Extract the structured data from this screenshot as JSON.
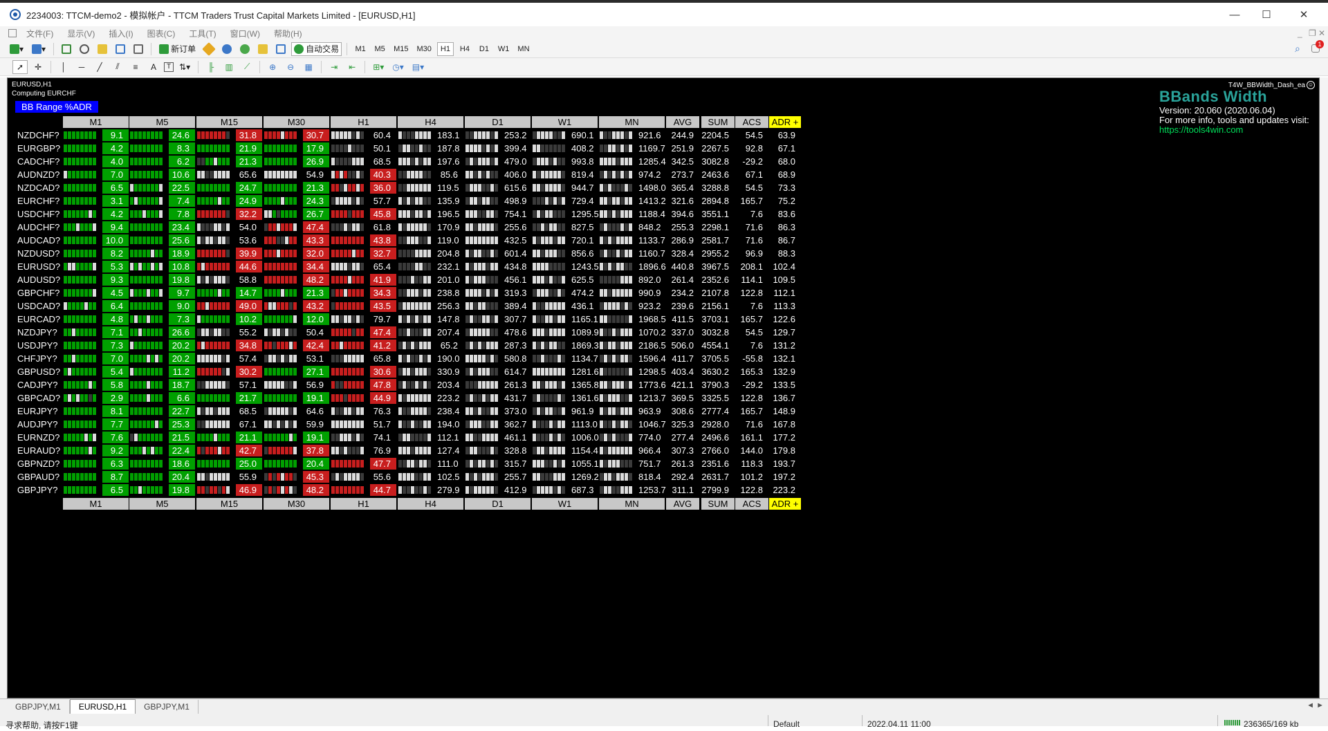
{
  "window": {
    "title": "2234003: TTCM-demo2 - 模拟帐户 - TTCM Traders Trust Capital Markets Limited - [EURUSD,H1]",
    "controls": [
      "—",
      "☐",
      "✕"
    ]
  },
  "menu": {
    "items": [
      "文件(F)",
      "显示(V)",
      "插入(I)",
      "图表(C)",
      "工具(T)",
      "窗口(W)",
      "帮助(H)"
    ],
    "right_controls": [
      "_",
      "❐",
      "✕"
    ]
  },
  "toolbar1": {
    "new_order_label": "新订单",
    "auto_trade_label": "自动交易",
    "timeframes": [
      "M1",
      "M5",
      "M15",
      "M30",
      "H1",
      "H4",
      "D1",
      "W1",
      "MN"
    ],
    "active_timeframe": "H1",
    "notification_count": "1"
  },
  "toolbar2": {
    "text_tool": "A",
    "label_tool": "T"
  },
  "chart": {
    "symbol_line": "EURUSD,H1",
    "computing": "Computing EURCHF",
    "ea_name": "T4W_BBWidth_Dash_ea",
    "ea_close": "☺",
    "badge": "BB Range %ADR",
    "brand_title": "BBands Width",
    "brand_version": "Version: 20.060 (2020.06.04)",
    "brand_info": "For more info, tools and updates visit:",
    "brand_link": "https://tools4win.com",
    "headers": [
      "M1",
      "M5",
      "M15",
      "M30",
      "H1",
      "H4",
      "D1",
      "W1",
      "MN",
      "AVG",
      "SUM",
      "ACS",
      "ADR +"
    ],
    "colors": {
      "green": "#00a000",
      "red": "#c81e1e",
      "bar_white": "#dcdcdc",
      "bar_dark": "#3a3a3a",
      "adr_header": "#ffff00"
    },
    "rows": [
      {
        "pair": "NZDCHF?",
        "v": [
          "9.1",
          "24.6",
          "31.8",
          "30.7",
          "60.4",
          "183.1",
          "253.2",
          "690.1",
          "921.6"
        ],
        "avg": "244.9",
        "sum": "2204.5",
        "acs": "54.5",
        "adr": "63.9"
      },
      {
        "pair": "EURGBP?",
        "v": [
          "4.2",
          "8.3",
          "21.9",
          "17.9",
          "50.1",
          "187.8",
          "399.4",
          "408.2",
          "1169.7"
        ],
        "avg": "251.9",
        "sum": "2267.5",
        "acs": "92.8",
        "adr": "67.1"
      },
      {
        "pair": "CADCHF?",
        "v": [
          "4.0",
          "6.2",
          "21.3",
          "26.9",
          "68.5",
          "197.6",
          "479.0",
          "993.8",
          "1285.4"
        ],
        "avg": "342.5",
        "sum": "3082.8",
        "acs": "-29.2",
        "adr": "68.0"
      },
      {
        "pair": "AUDNZD?",
        "v": [
          "7.0",
          "10.6",
          "65.6",
          "54.9",
          "40.3",
          "85.6",
          "406.0",
          "819.4",
          "974.2"
        ],
        "avg": "273.7",
        "sum": "2463.6",
        "acs": "67.1",
        "adr": "68.9"
      },
      {
        "pair": "NZDCAD?",
        "v": [
          "6.5",
          "22.5",
          "24.7",
          "21.3",
          "36.0",
          "119.5",
          "615.6",
          "944.7",
          "1498.0"
        ],
        "avg": "365.4",
        "sum": "3288.8",
        "acs": "54.5",
        "adr": "73.3"
      },
      {
        "pair": "EURCHF?",
        "v": [
          "3.1",
          "7.4",
          "24.9",
          "24.3",
          "57.7",
          "135.9",
          "498.9",
          "729.4",
          "1413.2"
        ],
        "avg": "321.6",
        "sum": "2894.8",
        "acs": "165.7",
        "adr": "75.2"
      },
      {
        "pair": "USDCHF?",
        "v": [
          "4.2",
          "7.8",
          "32.2",
          "26.7",
          "45.8",
          "196.5",
          "754.1",
          "1295.5",
          "1188.4"
        ],
        "avg": "394.6",
        "sum": "3551.1",
        "acs": "7.6",
        "adr": "83.6"
      },
      {
        "pair": "AUDCHF?",
        "v": [
          "9.4",
          "23.4",
          "54.0",
          "47.4",
          "61.8",
          "170.9",
          "255.6",
          "827.5",
          "848.2"
        ],
        "avg": "255.3",
        "sum": "2298.1",
        "acs": "71.6",
        "adr": "86.3"
      },
      {
        "pair": "AUDCAD?",
        "v": [
          "10.0",
          "25.6",
          "53.6",
          "43.3",
          "43.8",
          "119.0",
          "432.5",
          "720.1",
          "1133.7"
        ],
        "avg": "286.9",
        "sum": "2581.7",
        "acs": "71.6",
        "adr": "86.7"
      },
      {
        "pair": "NZDUSD?",
        "v": [
          "8.2",
          "18.9",
          "39.9",
          "32.0",
          "32.7",
          "204.8",
          "601.4",
          "856.6",
          "1160.7"
        ],
        "avg": "328.4",
        "sum": "2955.2",
        "acs": "96.9",
        "adr": "88.3"
      },
      {
        "pair": "EURUSD?",
        "v": [
          "5.3",
          "10.8",
          "44.6",
          "34.4",
          "65.4",
          "232.1",
          "434.8",
          "1243.5",
          "1896.6"
        ],
        "avg": "440.8",
        "sum": "3967.5",
        "acs": "208.1",
        "adr": "102.4"
      },
      {
        "pair": "AUDUSD?",
        "v": [
          "9.3",
          "19.8",
          "58.8",
          "48.2",
          "41.9",
          "201.0",
          "456.1",
          "625.5",
          "892.0"
        ],
        "avg": "261.4",
        "sum": "2352.6",
        "acs": "114.1",
        "adr": "109.5"
      },
      {
        "pair": "GBPCHF?",
        "v": [
          "4.5",
          "9.7",
          "14.7",
          "21.3",
          "34.3",
          "238.8",
          "319.3",
          "474.2",
          "990.9"
        ],
        "avg": "234.2",
        "sum": "2107.8",
        "acs": "122.8",
        "adr": "112.1"
      },
      {
        "pair": "USDCAD?",
        "v": [
          "6.4",
          "9.0",
          "49.0",
          "43.2",
          "43.5",
          "256.3",
          "389.4",
          "436.1",
          "923.2"
        ],
        "avg": "239.6",
        "sum": "2156.1",
        "acs": "7.6",
        "adr": "113.3"
      },
      {
        "pair": "EURCAD?",
        "v": [
          "4.8",
          "7.3",
          "10.2",
          "12.0",
          "79.7",
          "147.8",
          "307.7",
          "1165.1",
          "1968.5"
        ],
        "avg": "411.5",
        "sum": "3703.1",
        "acs": "165.7",
        "adr": "122.6"
      },
      {
        "pair": "NZDJPY?",
        "v": [
          "7.1",
          "26.6",
          "55.2",
          "50.4",
          "47.4",
          "207.4",
          "478.6",
          "1089.9",
          "1070.2"
        ],
        "avg": "337.0",
        "sum": "3032.8",
        "acs": "54.5",
        "adr": "129.7"
      },
      {
        "pair": "USDJPY?",
        "v": [
          "7.3",
          "20.2",
          "34.8",
          "42.4",
          "41.2",
          "65.2",
          "287.3",
          "1869.3",
          "2186.5"
        ],
        "avg": "506.0",
        "sum": "4554.1",
        "acs": "7.6",
        "adr": "131.2"
      },
      {
        "pair": "CHFJPY?",
        "v": [
          "7.0",
          "20.2",
          "57.4",
          "53.1",
          "65.8",
          "190.0",
          "580.8",
          "1134.7",
          "1596.4"
        ],
        "avg": "411.7",
        "sum": "3705.5",
        "acs": "-55.8",
        "adr": "132.1"
      },
      {
        "pair": "GBPUSD?",
        "v": [
          "5.4",
          "11.2",
          "30.2",
          "27.1",
          "30.6",
          "330.9",
          "614.7",
          "1281.6",
          "1298.5"
        ],
        "avg": "403.4",
        "sum": "3630.2",
        "acs": "165.3",
        "adr": "132.9"
      },
      {
        "pair": "CADJPY?",
        "v": [
          "5.8",
          "18.7",
          "57.1",
          "56.9",
          "47.8",
          "203.4",
          "261.3",
          "1365.8",
          "1773.6"
        ],
        "avg": "421.1",
        "sum": "3790.3",
        "acs": "-29.2",
        "adr": "133.5"
      },
      {
        "pair": "GBPCAD?",
        "v": [
          "2.9",
          "6.6",
          "21.7",
          "19.1",
          "44.9",
          "223.2",
          "431.7",
          "1361.6",
          "1213.7"
        ],
        "avg": "369.5",
        "sum": "3325.5",
        "acs": "122.8",
        "adr": "136.7"
      },
      {
        "pair": "EURJPY?",
        "v": [
          "8.1",
          "22.7",
          "68.5",
          "64.6",
          "76.3",
          "238.4",
          "373.0",
          "961.9",
          "963.9"
        ],
        "avg": "308.6",
        "sum": "2777.4",
        "acs": "165.7",
        "adr": "148.9"
      },
      {
        "pair": "AUDJPY?",
        "v": [
          "7.7",
          "25.3",
          "67.1",
          "59.9",
          "51.7",
          "194.0",
          "362.7",
          "1113.0",
          "1046.7"
        ],
        "avg": "325.3",
        "sum": "2928.0",
        "acs": "71.6",
        "adr": "167.8"
      },
      {
        "pair": "EURNZD?",
        "v": [
          "7.6",
          "21.5",
          "21.1",
          "19.1",
          "74.1",
          "112.1",
          "461.1",
          "1006.0",
          "774.0"
        ],
        "avg": "277.4",
        "sum": "2496.6",
        "acs": "161.1",
        "adr": "177.2"
      },
      {
        "pair": "EURAUD?",
        "v": [
          "9.2",
          "22.4",
          "42.7",
          "37.8",
          "76.9",
          "127.4",
          "328.8",
          "1154.4",
          "966.4"
        ],
        "avg": "307.3",
        "sum": "2766.0",
        "acs": "144.0",
        "adr": "179.8"
      },
      {
        "pair": "GBPNZD?",
        "v": [
          "6.3",
          "18.6",
          "25.0",
          "20.4",
          "47.7",
          "111.0",
          "315.7",
          "1055.1",
          "751.7"
        ],
        "avg": "261.3",
        "sum": "2351.6",
        "acs": "118.3",
        "adr": "193.7"
      },
      {
        "pair": "GBPAUD?",
        "v": [
          "8.7",
          "20.4",
          "55.9",
          "45.3",
          "55.6",
          "102.5",
          "255.7",
          "1269.2",
          "818.4"
        ],
        "avg": "292.4",
        "sum": "2631.7",
        "acs": "101.2",
        "adr": "197.2"
      },
      {
        "pair": "GBPJPY?",
        "v": [
          "6.5",
          "19.8",
          "46.9",
          "48.2",
          "44.7",
          "279.9",
          "412.9",
          "687.3",
          "1253.7"
        ],
        "avg": "311.1",
        "sum": "2799.9",
        "acs": "122.8",
        "adr": "223.2"
      }
    ],
    "cell_colors": [
      [
        "g",
        "g",
        "r",
        "r",
        "n",
        "n",
        "n",
        "n",
        "n"
      ],
      [
        "g",
        "g",
        "g",
        "g",
        "n",
        "n",
        "n",
        "n",
        "n"
      ],
      [
        "g",
        "g",
        "g",
        "g",
        "n",
        "n",
        "n",
        "n",
        "n"
      ],
      [
        "g",
        "g",
        "n",
        "n",
        "r",
        "n",
        "n",
        "n",
        "n"
      ],
      [
        "g",
        "g",
        "g",
        "g",
        "r",
        "n",
        "n",
        "n",
        "n"
      ],
      [
        "g",
        "g",
        "g",
        "g",
        "n",
        "n",
        "n",
        "n",
        "n"
      ],
      [
        "g",
        "g",
        "r",
        "g",
        "r",
        "n",
        "n",
        "n",
        "n"
      ],
      [
        "g",
        "g",
        "n",
        "r",
        "n",
        "n",
        "n",
        "n",
        "n"
      ],
      [
        "g",
        "g",
        "n",
        "r",
        "r",
        "n",
        "n",
        "n",
        "n"
      ],
      [
        "g",
        "g",
        "r",
        "r",
        "r",
        "n",
        "n",
        "n",
        "n"
      ],
      [
        "g",
        "g",
        "r",
        "r",
        "n",
        "n",
        "n",
        "n",
        "n"
      ],
      [
        "g",
        "g",
        "n",
        "r",
        "r",
        "n",
        "n",
        "n",
        "n"
      ],
      [
        "g",
        "g",
        "g",
        "g",
        "r",
        "n",
        "n",
        "n",
        "n"
      ],
      [
        "g",
        "g",
        "r",
        "r",
        "r",
        "n",
        "n",
        "n",
        "n"
      ],
      [
        "g",
        "g",
        "g",
        "g",
        "n",
        "n",
        "n",
        "n",
        "n"
      ],
      [
        "g",
        "g",
        "n",
        "n",
        "r",
        "n",
        "n",
        "n",
        "n"
      ],
      [
        "g",
        "g",
        "r",
        "r",
        "r",
        "n",
        "n",
        "n",
        "n"
      ],
      [
        "g",
        "g",
        "n",
        "n",
        "n",
        "n",
        "n",
        "n",
        "n"
      ],
      [
        "g",
        "g",
        "r",
        "g",
        "r",
        "n",
        "n",
        "n",
        "n"
      ],
      [
        "g",
        "g",
        "n",
        "n",
        "r",
        "n",
        "n",
        "n",
        "n"
      ],
      [
        "g",
        "g",
        "g",
        "g",
        "r",
        "n",
        "n",
        "n",
        "n"
      ],
      [
        "g",
        "g",
        "n",
        "n",
        "n",
        "n",
        "n",
        "n",
        "n"
      ],
      [
        "g",
        "g",
        "n",
        "n",
        "n",
        "n",
        "n",
        "n",
        "n"
      ],
      [
        "g",
        "g",
        "g",
        "g",
        "n",
        "n",
        "n",
        "n",
        "n"
      ],
      [
        "g",
        "g",
        "r",
        "r",
        "n",
        "n",
        "n",
        "n",
        "n"
      ],
      [
        "g",
        "g",
        "g",
        "g",
        "r",
        "n",
        "n",
        "n",
        "n"
      ],
      [
        "g",
        "g",
        "n",
        "r",
        "n",
        "n",
        "n",
        "n",
        "n"
      ],
      [
        "g",
        "g",
        "r",
        "r",
        "r",
        "n",
        "n",
        "n",
        "n"
      ]
    ]
  },
  "tabs": [
    {
      "label": "GBPJPY,M1",
      "active": false
    },
    {
      "label": "EURUSD,H1",
      "active": true
    },
    {
      "label": "GBPJPY,M1",
      "active": false
    }
  ],
  "tab_arrows": "◄ ►",
  "status": {
    "help": "寻求帮助, 请按F1键",
    "profile": "Default",
    "datetime": "2022.04.11 11:00",
    "traffic": "236365/169 kb"
  }
}
